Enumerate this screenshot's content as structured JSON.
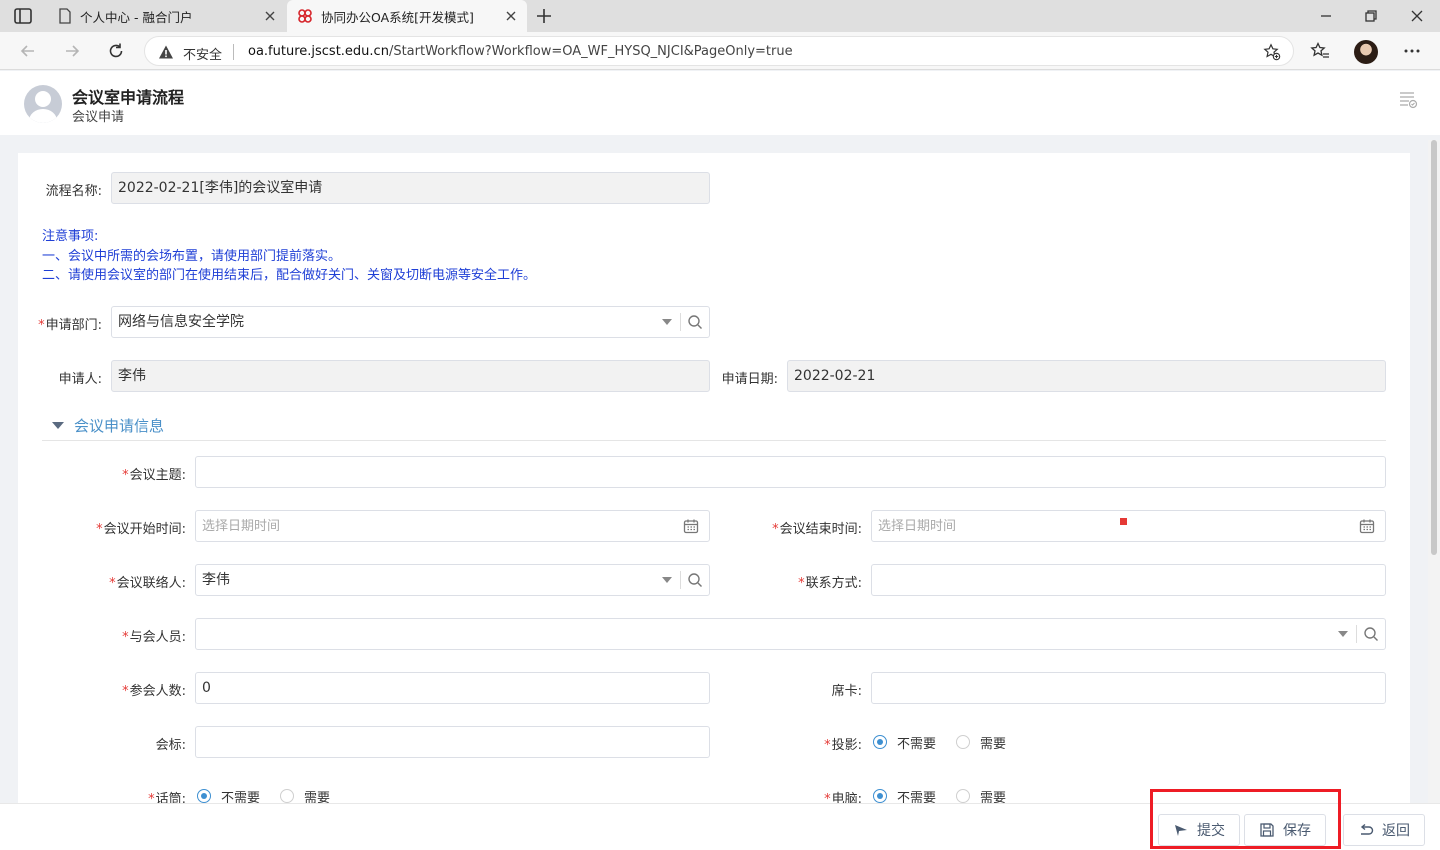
{
  "browser": {
    "tabs": [
      {
        "title": "个人中心 - 融合门户",
        "active": false
      },
      {
        "title": "协同办公OA系统[开发模式]",
        "active": true
      }
    ],
    "security_label": "不安全",
    "url_host": "oa.future.jscst.edu.cn",
    "url_path": "/StartWorkflow?Workflow=OA_WF_HYSQ_NJCI&PageOnly=true"
  },
  "header": {
    "title": "会议室申请流程",
    "subtitle": "会议申请"
  },
  "form": {
    "process_name_label": "流程名称:",
    "process_name_value": "2022-02-21[李伟]的会议室申请",
    "notice_lines": [
      "注意事项:",
      "一、会议中所需的会场布置，请使用部门提前落实。",
      "二、请使用会议室的部门在使用结束后，配合做好关门、关窗及切断电源等安全工作。"
    ],
    "dept_label": "申请部门:",
    "dept_value": "网络与信息安全学院",
    "applicant_label": "申请人:",
    "applicant_value": "李伟",
    "apply_date_label": "申请日期:",
    "apply_date_value": "2022-02-21",
    "section_title": "会议申请信息",
    "topic_label": "会议主题:",
    "topic_value": "",
    "start_label": "会议开始时间:",
    "start_placeholder": "选择日期时间",
    "end_label": "会议结束时间:",
    "end_placeholder": "选择日期时间",
    "contact_label": "会议联络人:",
    "contact_value": "李伟",
    "phone_label": "联系方式:",
    "phone_value": "",
    "attendees_label": "与会人员:",
    "attendees_value": "",
    "count_label": "参会人数:",
    "count_value": "0",
    "namecard_label": "席卡:",
    "namecard_value": "",
    "banner_label": "会标:",
    "banner_value": "",
    "projector_label": "投影:",
    "mic_label": "话筒:",
    "computer_label": "电脑:",
    "option_no": "不需要",
    "option_yes": "需要",
    "projector_selected": "不需要",
    "mic_selected": "不需要",
    "computer_selected": "不需要"
  },
  "footer": {
    "submit": "提交",
    "save": "保存",
    "back": "返回"
  },
  "colors": {
    "notice": "#1f3fd6",
    "section_title": "#4a90c8",
    "required": "#e53935",
    "highlight": "#ee1c25",
    "radio_on": "#3d8fd1"
  }
}
